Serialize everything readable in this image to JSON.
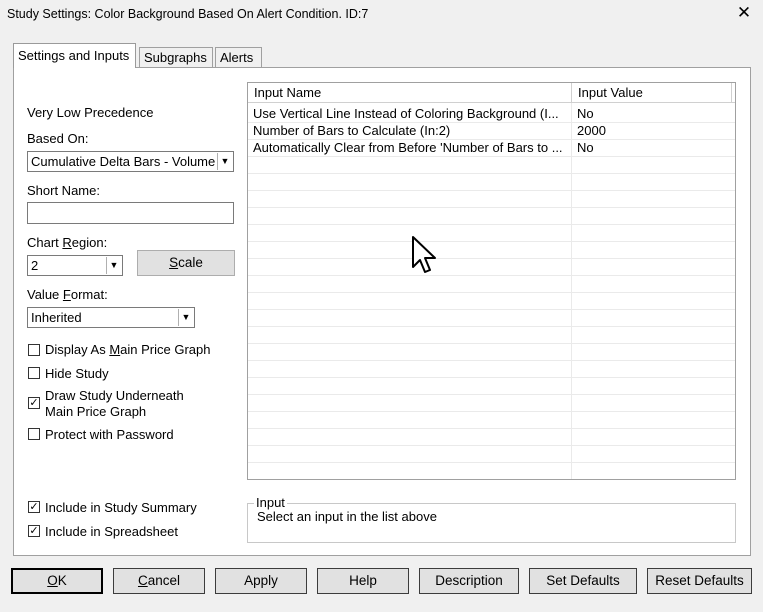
{
  "window": {
    "title": "Study Settings: Color Background Based On Alert Condition. ID:7",
    "close_glyph": "✕"
  },
  "tabs": [
    {
      "label": "Settings and Inputs",
      "active": true
    },
    {
      "label": "Subgraphs",
      "active": false
    },
    {
      "label": "Alerts",
      "active": false
    }
  ],
  "settings": {
    "precedence": "Very Low Precedence",
    "based_on_label": "Based On:",
    "based_on_value": "Cumulative Delta Bars - Volume",
    "short_name_label": "Short Name:",
    "short_name_value": "",
    "chart_region_label_pre": "Chart ",
    "chart_region_label_u": "R",
    "chart_region_label_post": "egion:",
    "chart_region_value": "2",
    "scale_u": "S",
    "scale_rest": "cale",
    "value_format_label_pre": "Value ",
    "value_format_label_u": "F",
    "value_format_label_post": "ormat:",
    "value_format_value": "Inherited",
    "checkboxes": [
      {
        "label_pre": "Display As ",
        "label_u": "M",
        "label_post": "ain Price Graph",
        "checked": false
      },
      {
        "label_pre": "Hide Study",
        "label_u": "",
        "label_post": "",
        "checked": false
      },
      {
        "label_pre": "Draw Study Underneath",
        "label_u": "",
        "label_post": "",
        "line2": "Main Price Graph",
        "checked": true
      },
      {
        "label_pre": "Protect with Password",
        "label_u": "",
        "label_post": "",
        "checked": false
      }
    ],
    "bottom_checkboxes": [
      {
        "label": "Include in Study Summary",
        "checked": true
      },
      {
        "label": "Include in Spreadsheet",
        "checked": true
      }
    ],
    "check_glyph": "✓"
  },
  "inputs_table": {
    "columns": [
      "Input Name",
      "Input Value"
    ],
    "rows": [
      {
        "name": "Use Vertical Line Instead of Coloring Background   (I...",
        "value": "No"
      },
      {
        "name": "Number of Bars to Calculate   (In:2)",
        "value": "2000"
      },
      {
        "name": "Automatically Clear from Before 'Number of Bars to ...",
        "value": "No"
      }
    ]
  },
  "input_group": {
    "legend": "Input",
    "hint": "Select an input in the list above"
  },
  "buttons": {
    "ok_u": "O",
    "ok_rest": "K",
    "cancel_u": "C",
    "cancel_rest": "ancel",
    "apply": "Apply",
    "help": "Help",
    "description": "Description",
    "set_defaults": "Set Defaults",
    "reset_defaults": "Reset Defaults"
  },
  "dropdown_glyph": "▼"
}
